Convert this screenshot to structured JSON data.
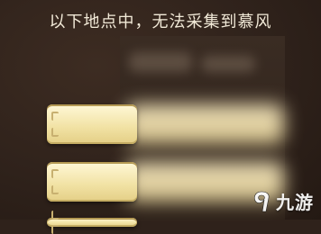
{
  "question": {
    "text": "以下地点中，无法采集到慕风"
  },
  "options": [
    {
      "label": ""
    },
    {
      "label": ""
    },
    {
      "label": ""
    }
  ],
  "watermark": {
    "brand_text": "九游",
    "logo_icon": "9-logo-icon"
  },
  "colors": {
    "background": "#2f221b",
    "option_fill": "#f2e3a6",
    "question_text": "#f2ead8"
  }
}
